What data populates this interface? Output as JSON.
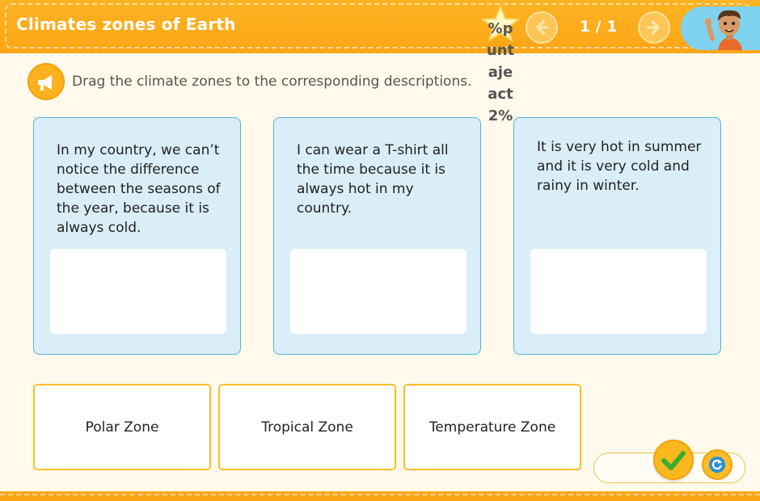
{
  "header": {
    "title": "Climates zones of Earth",
    "score_lines": [
      "%p",
      "unt",
      "aje",
      "act",
      "2%"
    ],
    "page_counter": "1 / 1",
    "icons": {
      "star": "star-icon",
      "prev": "arrow-left-icon",
      "next": "arrow-right-icon",
      "avatar": "boy-waving-avatar"
    }
  },
  "instruction": {
    "icon": "megaphone-icon",
    "text": "Drag the climate zones to the corresponding descriptions."
  },
  "cards": [
    {
      "text": "In my country, we can’t notice the difference between the seasons of the year, because it is always cold."
    },
    {
      "text": "I can wear a T-shirt all the time because it is always hot in my country."
    },
    {
      "text": "It is very hot in summer and it is very cold and rainy in winter."
    }
  ],
  "options": [
    {
      "label": "Polar Zone"
    },
    {
      "label": "Tropical Zone"
    },
    {
      "label": "Temperature Zone"
    }
  ],
  "controls": {
    "check_icon": "checkmark-icon",
    "reset_icon": "reset-icon"
  },
  "colors": {
    "accent": "#fba516",
    "card_bg": "#d9eef6",
    "card_border": "#4fb4e2",
    "check_green": "#3cad2f",
    "reset_blue": "#2a8fd6"
  }
}
